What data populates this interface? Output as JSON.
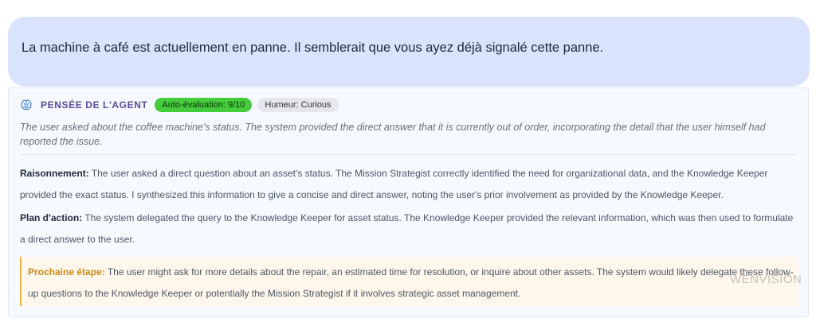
{
  "message": {
    "text": "La machine à café est actuellement en panne. Il semblerait que vous ayez déjà signalé cette panne."
  },
  "thought": {
    "title": "PENSÉE DE L'AGENT",
    "brain_icon": "brain-icon",
    "self_eval": "Auto-évaluation: 9/10",
    "mood": "Humeur: Curious",
    "summary": "The user asked about the coffee machine's status. The system provided the direct answer that it is currently out of order, incorporating the detail that the user himself had reported the issue.",
    "reasoning_label": "Raisonnement:",
    "reasoning_text": " The user asked a direct question about an asset's status. The Mission Strategist correctly identified the need for organizational data, and the Knowledge Keeper provided the exact status. I synthesized this information to give a concise and direct answer, noting the user's prior involvement as provided by the Knowledge Keeper.",
    "plan_label": "Plan d'action:",
    "plan_text": " The system delegated the query to the Knowledge Keeper for asset status. The Knowledge Keeper provided the relevant information, which was then used to formulate a direct answer to the user.",
    "next_label": "Prochaine étape:",
    "next_text": " The user might ask for more details about the repair, an estimated time for resolution, or inquire about other assets. The system would likely delegate these follow-up questions to the Knowledge Keeper or potentially the Mission Strategist if it involves strategic asset management."
  },
  "watermark": "WENVISION",
  "colors": {
    "bubble": "#d9e3fc",
    "accent": "#5b4a9c",
    "eval_badge": "#44cc3c",
    "next_border": "#e7b44a"
  }
}
